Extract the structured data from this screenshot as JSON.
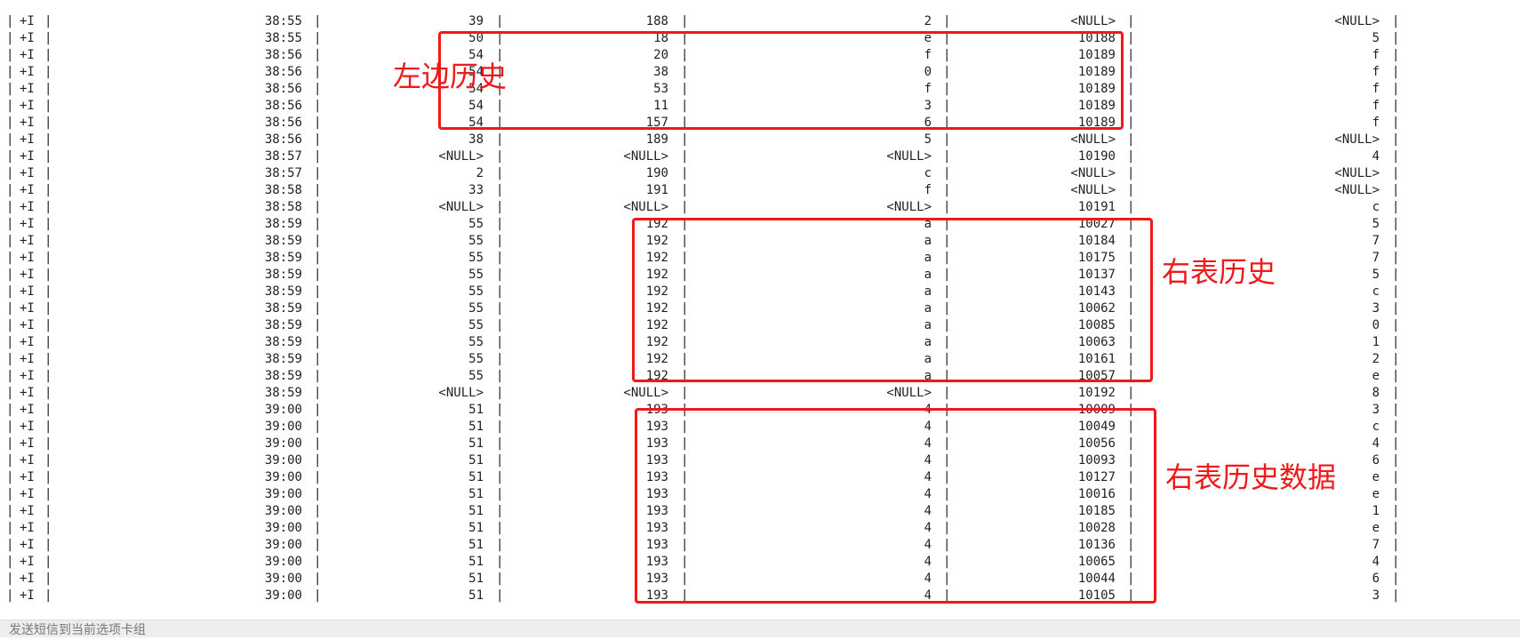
{
  "terminal": {
    "rows": [
      [
        "+I",
        "38:55",
        "39",
        "188",
        "2",
        "<NULL>",
        "<NULL>"
      ],
      [
        "+I",
        "38:55",
        "50",
        "18",
        "e",
        "10188",
        "5"
      ],
      [
        "+I",
        "38:56",
        "54",
        "20",
        "f",
        "10189",
        "f"
      ],
      [
        "+I",
        "38:56",
        "54",
        "38",
        "0",
        "10189",
        "f"
      ],
      [
        "+I",
        "38:56",
        "54",
        "53",
        "f",
        "10189",
        "f"
      ],
      [
        "+I",
        "38:56",
        "54",
        "11",
        "3",
        "10189",
        "f"
      ],
      [
        "+I",
        "38:56",
        "54",
        "157",
        "6",
        "10189",
        "f"
      ],
      [
        "+I",
        "38:56",
        "38",
        "189",
        "5",
        "<NULL>",
        "<NULL>"
      ],
      [
        "+I",
        "38:57",
        "<NULL>",
        "<NULL>",
        "<NULL>",
        "10190",
        "4"
      ],
      [
        "+I",
        "38:57",
        "2",
        "190",
        "c",
        "<NULL>",
        "<NULL>"
      ],
      [
        "+I",
        "38:58",
        "33",
        "191",
        "f",
        "<NULL>",
        "<NULL>"
      ],
      [
        "+I",
        "38:58",
        "<NULL>",
        "<NULL>",
        "<NULL>",
        "10191",
        "c"
      ],
      [
        "+I",
        "38:59",
        "55",
        "192",
        "a",
        "10027",
        "5"
      ],
      [
        "+I",
        "38:59",
        "55",
        "192",
        "a",
        "10184",
        "7"
      ],
      [
        "+I",
        "38:59",
        "55",
        "192",
        "a",
        "10175",
        "7"
      ],
      [
        "+I",
        "38:59",
        "55",
        "192",
        "a",
        "10137",
        "5"
      ],
      [
        "+I",
        "38:59",
        "55",
        "192",
        "a",
        "10143",
        "c"
      ],
      [
        "+I",
        "38:59",
        "55",
        "192",
        "a",
        "10062",
        "3"
      ],
      [
        "+I",
        "38:59",
        "55",
        "192",
        "a",
        "10085",
        "0"
      ],
      [
        "+I",
        "38:59",
        "55",
        "192",
        "a",
        "10063",
        "1"
      ],
      [
        "+I",
        "38:59",
        "55",
        "192",
        "a",
        "10161",
        "2"
      ],
      [
        "+I",
        "38:59",
        "55",
        "192",
        "a",
        "10057",
        "e"
      ],
      [
        "+I",
        "38:59",
        "<NULL>",
        "<NULL>",
        "<NULL>",
        "10192",
        "8"
      ],
      [
        "+I",
        "39:00",
        "51",
        "193",
        "4",
        "10009",
        "3"
      ],
      [
        "+I",
        "39:00",
        "51",
        "193",
        "4",
        "10049",
        "c"
      ],
      [
        "+I",
        "39:00",
        "51",
        "193",
        "4",
        "10056",
        "4"
      ],
      [
        "+I",
        "39:00",
        "51",
        "193",
        "4",
        "10093",
        "6"
      ],
      [
        "+I",
        "39:00",
        "51",
        "193",
        "4",
        "10127",
        "e"
      ],
      [
        "+I",
        "39:00",
        "51",
        "193",
        "4",
        "10016",
        "e"
      ],
      [
        "+I",
        "39:00",
        "51",
        "193",
        "4",
        "10185",
        "1"
      ],
      [
        "+I",
        "39:00",
        "51",
        "193",
        "4",
        "10028",
        "e"
      ],
      [
        "+I",
        "39:00",
        "51",
        "193",
        "4",
        "10136",
        "7"
      ],
      [
        "+I",
        "39:00",
        "51",
        "193",
        "4",
        "10065",
        "4"
      ],
      [
        "+I",
        "39:00",
        "51",
        "193",
        "4",
        "10044",
        "6"
      ],
      [
        "+I",
        "39:00",
        "51",
        "193",
        "4",
        "10105",
        "3"
      ]
    ],
    "pipe": "|"
  },
  "annotations": [
    {
      "label": "左边历史",
      "color": "#f01818"
    },
    {
      "label": "右表历史",
      "color": "#f01818"
    },
    {
      "label": "右表历史数据",
      "color": "#f01818"
    }
  ],
  "input_bar": {
    "placeholder": "发送短信到当前选项卡组"
  }
}
